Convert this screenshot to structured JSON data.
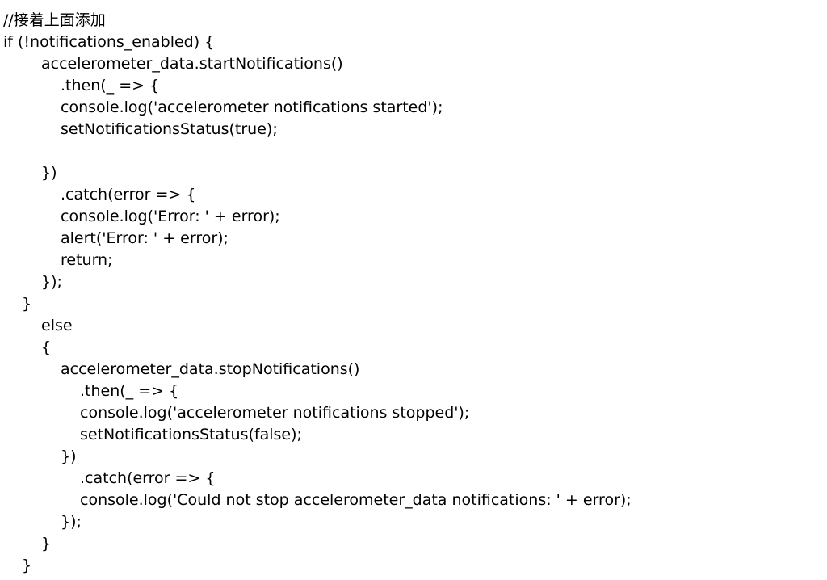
{
  "document": {
    "lines": [
      {
        "indent": 0,
        "text": "//接着上面添加"
      },
      {
        "indent": 0,
        "text": "if (!notifications_enabled) {"
      },
      {
        "indent": 2,
        "text": "accelerometer_data.startNotifications()"
      },
      {
        "indent": 3,
        "text": ".then(_ => {"
      },
      {
        "indent": 3,
        "text": "console.log('accelerometer notifications started');"
      },
      {
        "indent": 3,
        "text": "setNotificationsStatus(true);"
      },
      {
        "indent": 0,
        "text": ""
      },
      {
        "indent": 2,
        "text": "})"
      },
      {
        "indent": 3,
        "text": ".catch(error => {"
      },
      {
        "indent": 3,
        "text": "console.log('Error: ' + error);"
      },
      {
        "indent": 3,
        "text": "alert('Error: ' + error);"
      },
      {
        "indent": 3,
        "text": "return;"
      },
      {
        "indent": 2,
        "text": "});"
      },
      {
        "indent": 1,
        "text": "}"
      },
      {
        "indent": 2,
        "text": "else"
      },
      {
        "indent": 2,
        "text": "{"
      },
      {
        "indent": 3,
        "text": "accelerometer_data.stopNotifications()"
      },
      {
        "indent": 4,
        "text": ".then(_ => {"
      },
      {
        "indent": 4,
        "text": "console.log('accelerometer notifications stopped');"
      },
      {
        "indent": 4,
        "text": "setNotificationsStatus(false);"
      },
      {
        "indent": 3,
        "text": "})"
      },
      {
        "indent": 4,
        "text": ".catch(error => {"
      },
      {
        "indent": 4,
        "text": "console.log('Could not stop accelerometer_data notifications: ' + error);"
      },
      {
        "indent": 3,
        "text": "});"
      },
      {
        "indent": 2,
        "text": "}"
      },
      {
        "indent": 1,
        "text": "}"
      }
    ]
  }
}
